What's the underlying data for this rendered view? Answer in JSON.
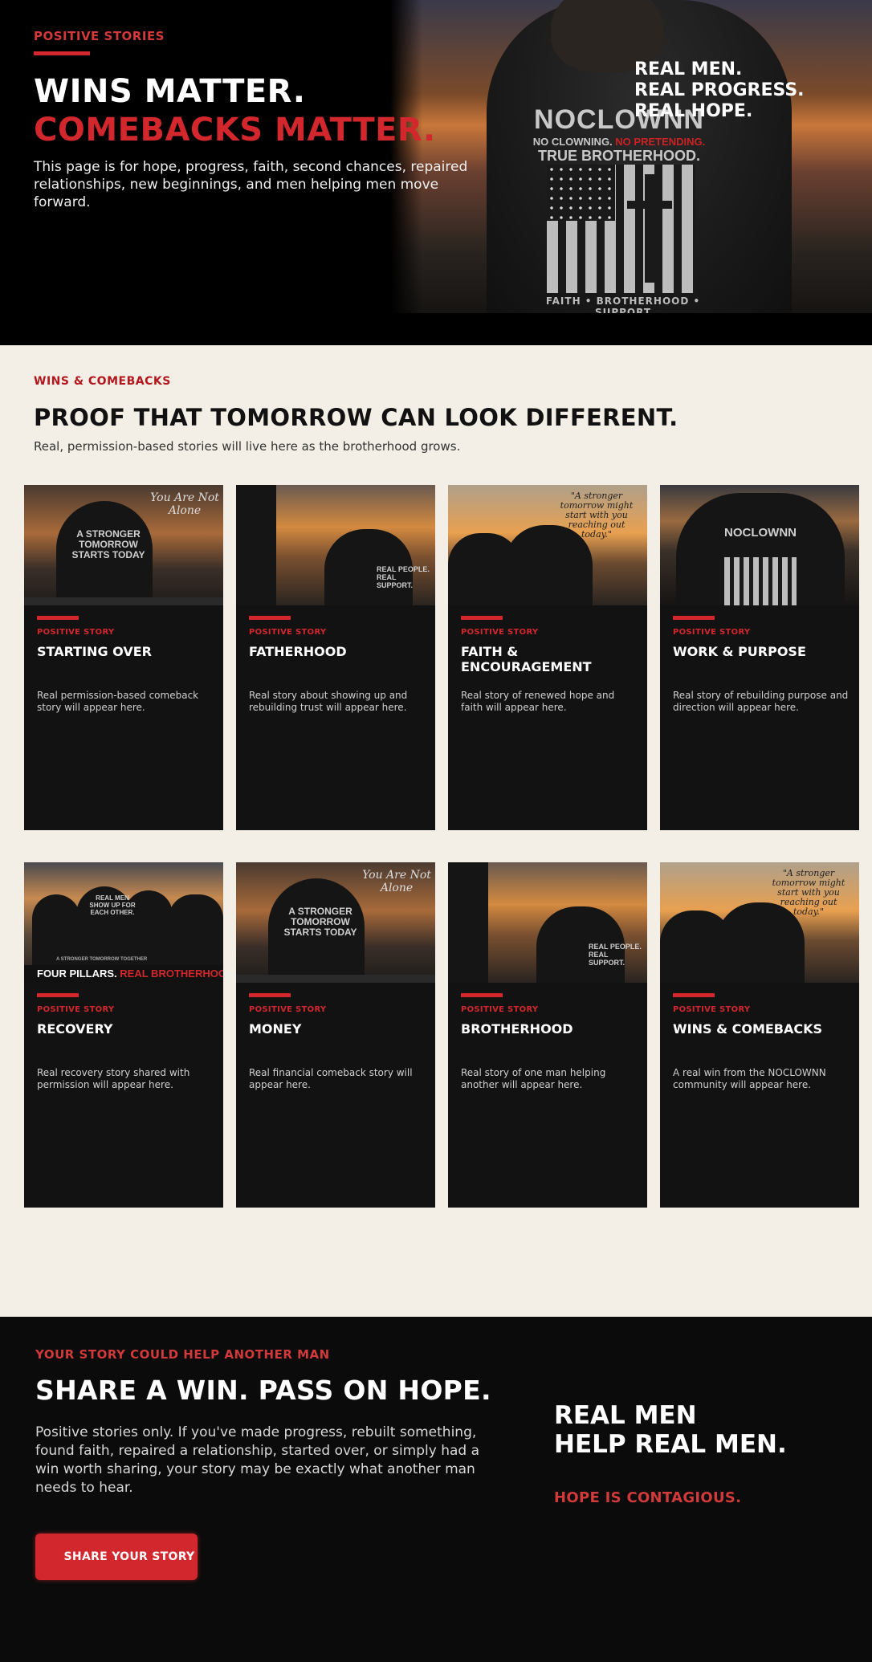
{
  "hero": {
    "eyebrow": "POSITIVE STORIES",
    "headline_1": "WINS MATTER.",
    "headline_2": "COMEBACKS MATTER.",
    "lede": "This page is for hope, progress, faith, second chances, repaired relationships, new beginnings, and men helping men move forward.",
    "side_1": "REAL MEN.",
    "side_2": "REAL PROGRESS.",
    "side_3": "REAL HOPE.",
    "shirt": {
      "brand": "NOCLOWNN",
      "line_a": "NO CLOWNING.",
      "line_b": "NO PRETENDING.",
      "line_c": "TRUE BROTHERHOOD.",
      "footer": "FAITH • BROTHERHOOD • SUPPORT"
    }
  },
  "section": {
    "eyebrow": "WINS & COMEBACKS",
    "title": "PROOF THAT TOMORROW CAN LOOK DIFFERENT.",
    "subtitle": "Real, permission-based stories will live here as the brotherhood grows."
  },
  "cards": [
    {
      "tag": "POSITIVE STORY",
      "title": "STARTING OVER",
      "desc": "Real permission-based comeback story will appear here."
    },
    {
      "tag": "POSITIVE STORY",
      "title": "FATHERHOOD",
      "desc": "Real story about showing up and rebuilding trust will appear here."
    },
    {
      "tag": "POSITIVE STORY",
      "title": "FAITH & ENCOURAGEMENT",
      "desc": "Real story of renewed hope and faith will appear here."
    },
    {
      "tag": "POSITIVE STORY",
      "title": "WORK & PURPOSE",
      "desc": "Real story of rebuilding purpose and direction will appear here."
    },
    {
      "tag": "POSITIVE STORY",
      "title": "RECOVERY",
      "desc": "Real recovery story shared with permission will appear here."
    },
    {
      "tag": "POSITIVE STORY",
      "title": "MONEY",
      "desc": "Real financial comeback story will appear here."
    },
    {
      "tag": "POSITIVE STORY",
      "title": "BROTHERHOOD",
      "desc": "Real story of one man helping another will appear here."
    },
    {
      "tag": "POSITIVE STORY",
      "title": "WINS & COMEBACKS",
      "desc": "A real win from the NOCLOWNN community will appear here."
    }
  ],
  "images": {
    "stronger": {
      "script": "You Are Not Alone",
      "shirt": "A STRONGER TOMORROW STARTS TODAY"
    },
    "hands": {
      "shirt": "REAL PEOPLE. REAL SUPPORT."
    },
    "quote": {
      "script": "\"A stronger tomorrow might start with you reaching out today.\""
    },
    "pillars": {
      "shirt": "REAL MEN SHOW UP FOR EACH OTHER.",
      "small": "A STRONGER TOMORROW TOGETHER",
      "banner_a": "FOUR PILLARS.",
      "banner_b": "REAL BROTHERHOOD"
    }
  },
  "cta": {
    "eyebrow": "YOUR STORY COULD HELP ANOTHER MAN",
    "title": "SHARE A WIN. PASS ON HOPE.",
    "body": "Positive stories only. If you've made progress, rebuilt something, found faith, repaired a relationship, started over, or simply had a win worth sharing, your story may be exactly what another man needs to hear.",
    "button": "SHARE YOUR STORY",
    "side_1": "REAL MEN",
    "side_2": "HELP REAL MEN.",
    "side_red": "HOPE IS CONTAGIOUS."
  },
  "colors": {
    "accent": "#d1272d",
    "dark": "#121212",
    "cream": "#f3eee6"
  }
}
